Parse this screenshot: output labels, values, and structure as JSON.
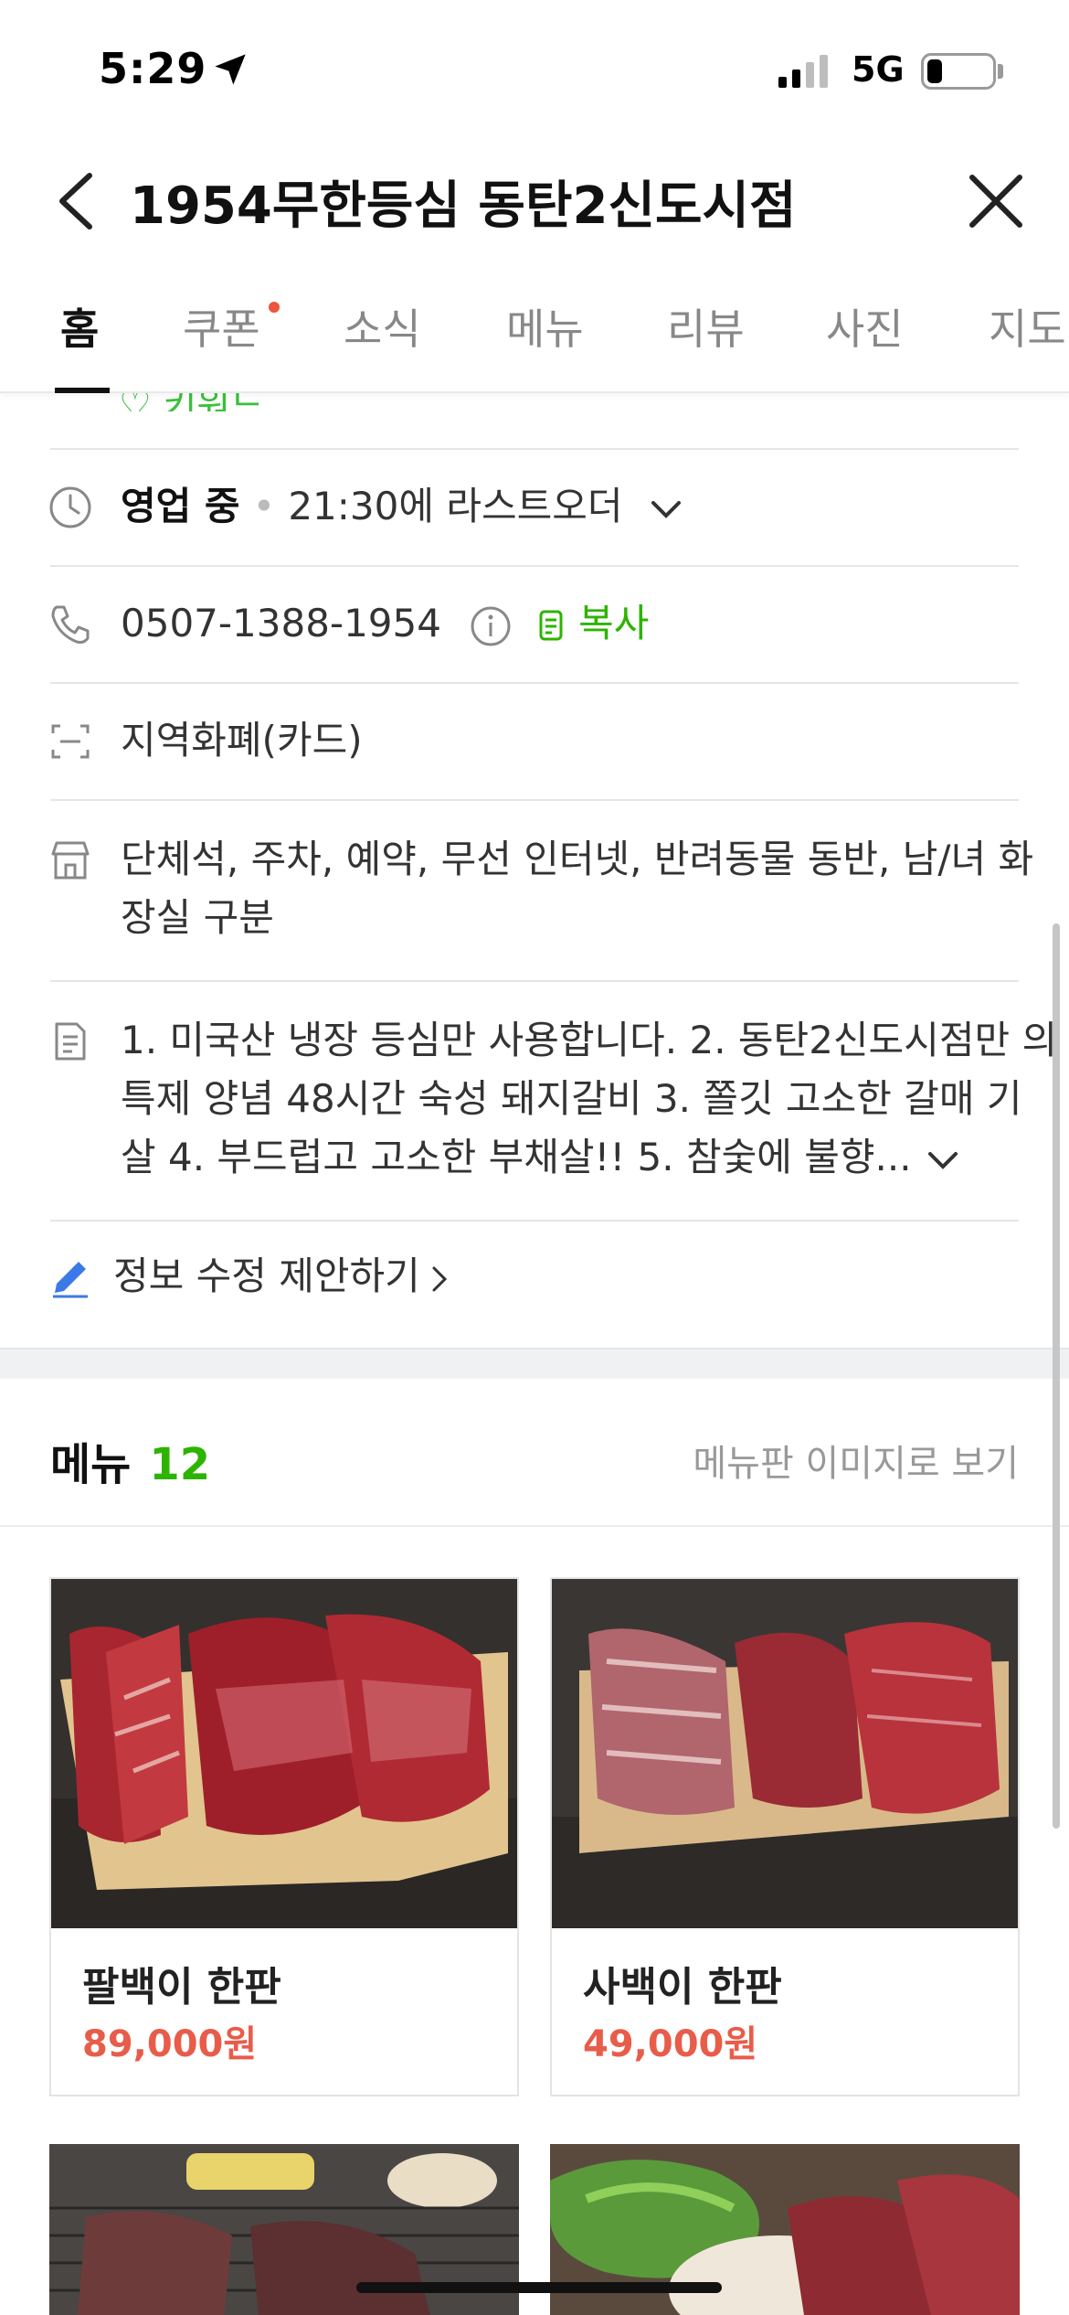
{
  "status_bar": {
    "time": "5:29",
    "network": "5G"
  },
  "header": {
    "title": "1954무한등심 동탄2신도시점"
  },
  "tabs": [
    {
      "label": "홈",
      "active": true
    },
    {
      "label": "쿠폰",
      "badge": true
    },
    {
      "label": "소식"
    },
    {
      "label": "메뉴"
    },
    {
      "label": "리뷰"
    },
    {
      "label": "사진"
    },
    {
      "label": "지도"
    }
  ],
  "info": {
    "cut_text": "♡ 키워드",
    "hours": {
      "status": "영업 중",
      "last_order": "21:30에 라스트오더"
    },
    "phone": {
      "number": "0507-1388-1954",
      "copy_label": "복사"
    },
    "payment": "지역화폐(카드)",
    "amenities_line1": "단체석, 주차, 예약, 무선 인터넷, 반려동물 동반, 남/녀 화",
    "amenities_line2": "장실 구분",
    "description_line1": "1. 미국산 냉장 등심만 사용합니다. 2. 동탄2신도시점만 의",
    "description_line2": "특제 양념 48시간 숙성 돼지갈비 3. 쫄깃 고소한 갈매 기",
    "description_line3": "살 4. 부드럽고 고소한 부채살!! 5. 참숯에 불향...",
    "suggest_edit": "정보 수정 제안하기"
  },
  "menu": {
    "title": "메뉴",
    "count": "12",
    "image_view_label": "메뉴판 이미지로 보기",
    "items": [
      {
        "name": "팔백이 한판",
        "price": "89,000원"
      },
      {
        "name": "사백이 한판",
        "price": "49,000원"
      }
    ]
  },
  "colors": {
    "accent_green": "#2db400",
    "price_red": "#e85c4a",
    "badge_red": "#f0533e"
  }
}
